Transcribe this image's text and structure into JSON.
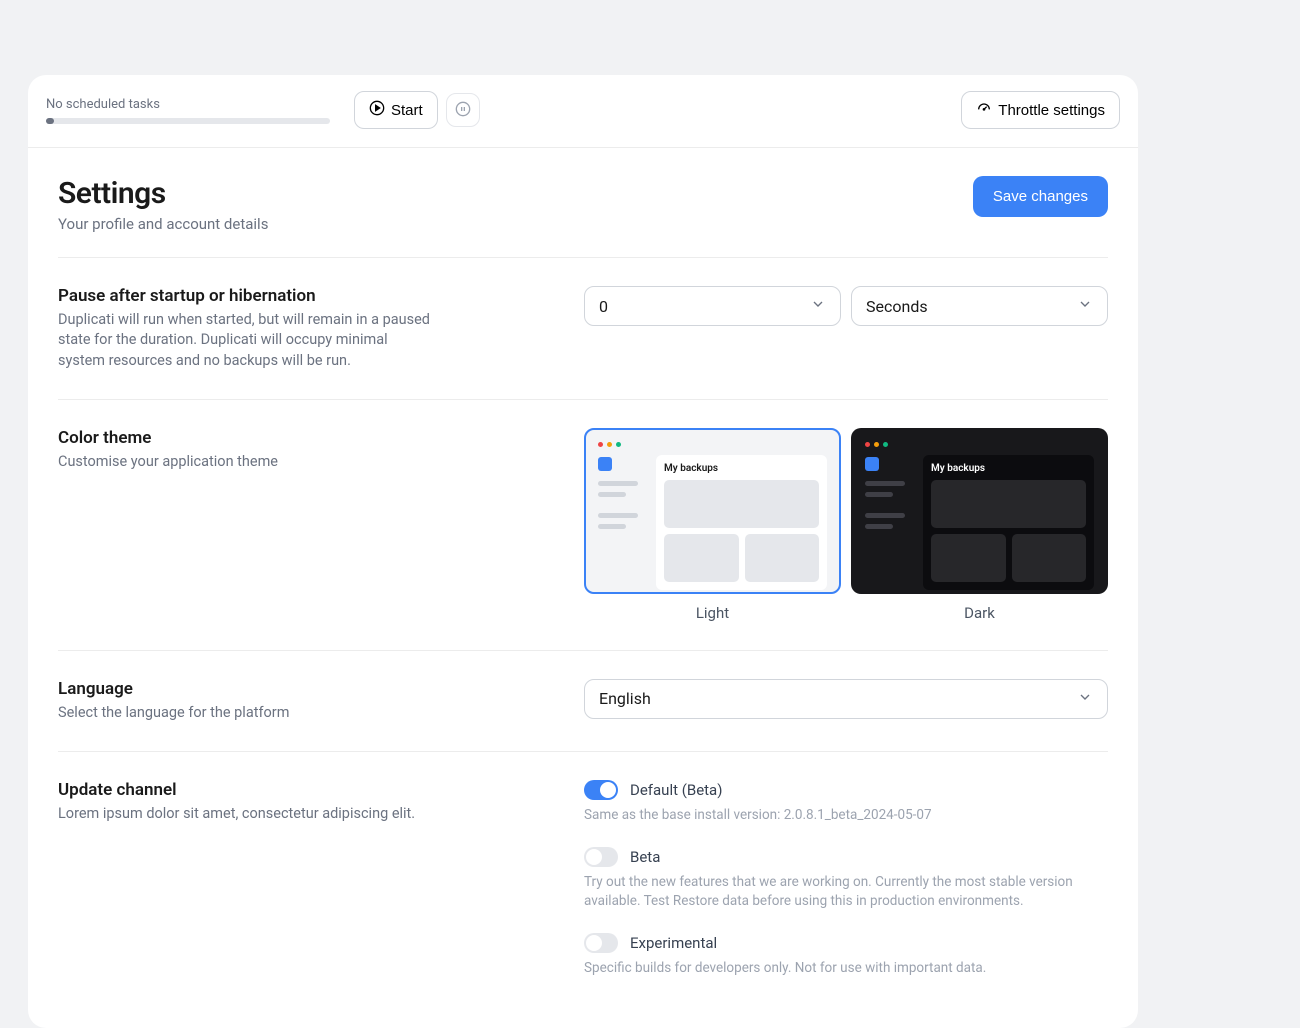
{
  "topbar": {
    "no_tasks": "No scheduled tasks",
    "start": "Start",
    "throttle": "Throttle settings"
  },
  "header": {
    "title": "Settings",
    "subtitle": "Your profile and account details",
    "save": "Save changes"
  },
  "pause": {
    "title": "Pause after startup or hibernation",
    "desc": "Duplicati will run when started, but will remain in a paused state for the duration. Duplicati will occupy minimal system resources and no backups will be run.",
    "value": "0",
    "unit": "Seconds"
  },
  "theme": {
    "title": "Color theme",
    "desc": "Customise your application theme",
    "preview_label": "My backups",
    "light": "Light",
    "dark": "Dark"
  },
  "language": {
    "title": "Language",
    "desc": "Select the language for the platform",
    "value": "English"
  },
  "channel": {
    "title": "Update channel",
    "desc": "Lorem ipsum dolor sit amet, consectetur adipiscing elit.",
    "options": {
      "default": {
        "label": "Default (Beta)",
        "desc": "Same as the base install version: 2.0.8.1_beta_2024-05-07"
      },
      "beta": {
        "label": "Beta",
        "desc": "Try out the new features that we are working on. Currently the most stable version available. Test Restore data before using this in production environments."
      },
      "experimental": {
        "label": "Experimental",
        "desc": "Specific builds for developers only. Not for use with important data."
      }
    }
  }
}
